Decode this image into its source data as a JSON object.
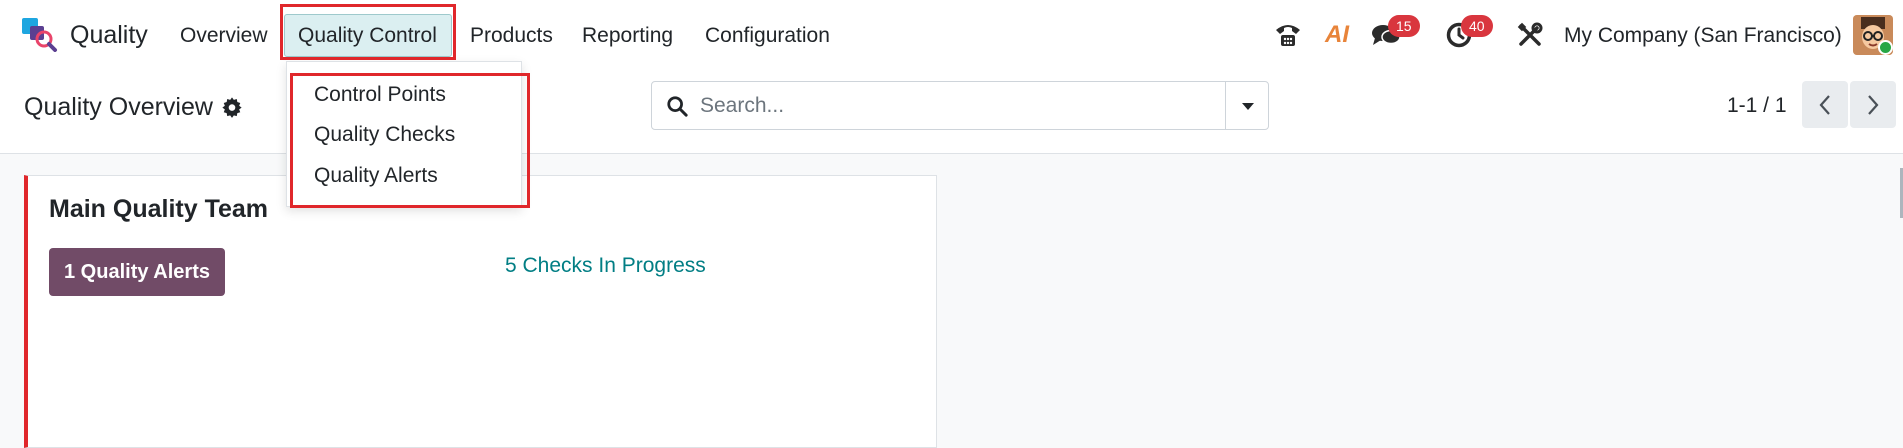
{
  "app": {
    "name": "Quality",
    "logo_icon": "quality-app-logo-icon"
  },
  "menu": {
    "items": [
      "Overview",
      "Quality Control",
      "Products",
      "Reporting",
      "Configuration"
    ],
    "active": "Quality Control"
  },
  "dropdown": {
    "items": [
      "Control Points",
      "Quality Checks",
      "Quality Alerts"
    ]
  },
  "systray": {
    "phone_icon": "phone-icon",
    "ai_label": "AI",
    "messages_count": "15",
    "activities_count": "40",
    "tools_icon": "tools-icon",
    "company": "My Company (San Francisco)"
  },
  "control_panel": {
    "title": "Quality Overview",
    "search_placeholder": "Search...",
    "pager": "1-1 / 1"
  },
  "card": {
    "title": "Main Quality Team",
    "alerts_button": "1 Quality Alerts",
    "checks_link": "5 Checks In Progress"
  },
  "colors": {
    "accent_purple": "#714b67",
    "link_teal": "#017e84",
    "highlight_red": "#e0272b",
    "badge_red": "#d9363e",
    "active_menu_bg": "#dbeff1"
  }
}
